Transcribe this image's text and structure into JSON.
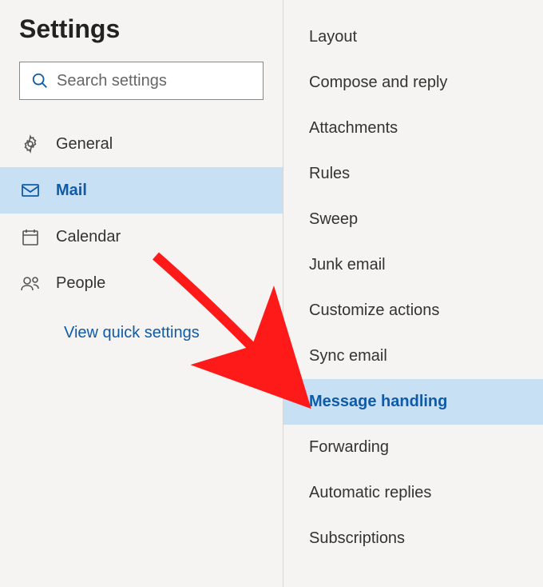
{
  "title": "Settings",
  "search": {
    "placeholder": "Search settings"
  },
  "nav": {
    "items": [
      {
        "label": "General"
      },
      {
        "label": "Mail"
      },
      {
        "label": "Calendar"
      },
      {
        "label": "People"
      }
    ],
    "quick_settings_label": "View quick settings"
  },
  "subnav": {
    "items": [
      {
        "label": "Layout"
      },
      {
        "label": "Compose and reply"
      },
      {
        "label": "Attachments"
      },
      {
        "label": "Rules"
      },
      {
        "label": "Sweep"
      },
      {
        "label": "Junk email"
      },
      {
        "label": "Customize actions"
      },
      {
        "label": "Sync email"
      },
      {
        "label": "Message handling"
      },
      {
        "label": "Forwarding"
      },
      {
        "label": "Automatic replies"
      },
      {
        "label": "Subscriptions"
      }
    ]
  }
}
